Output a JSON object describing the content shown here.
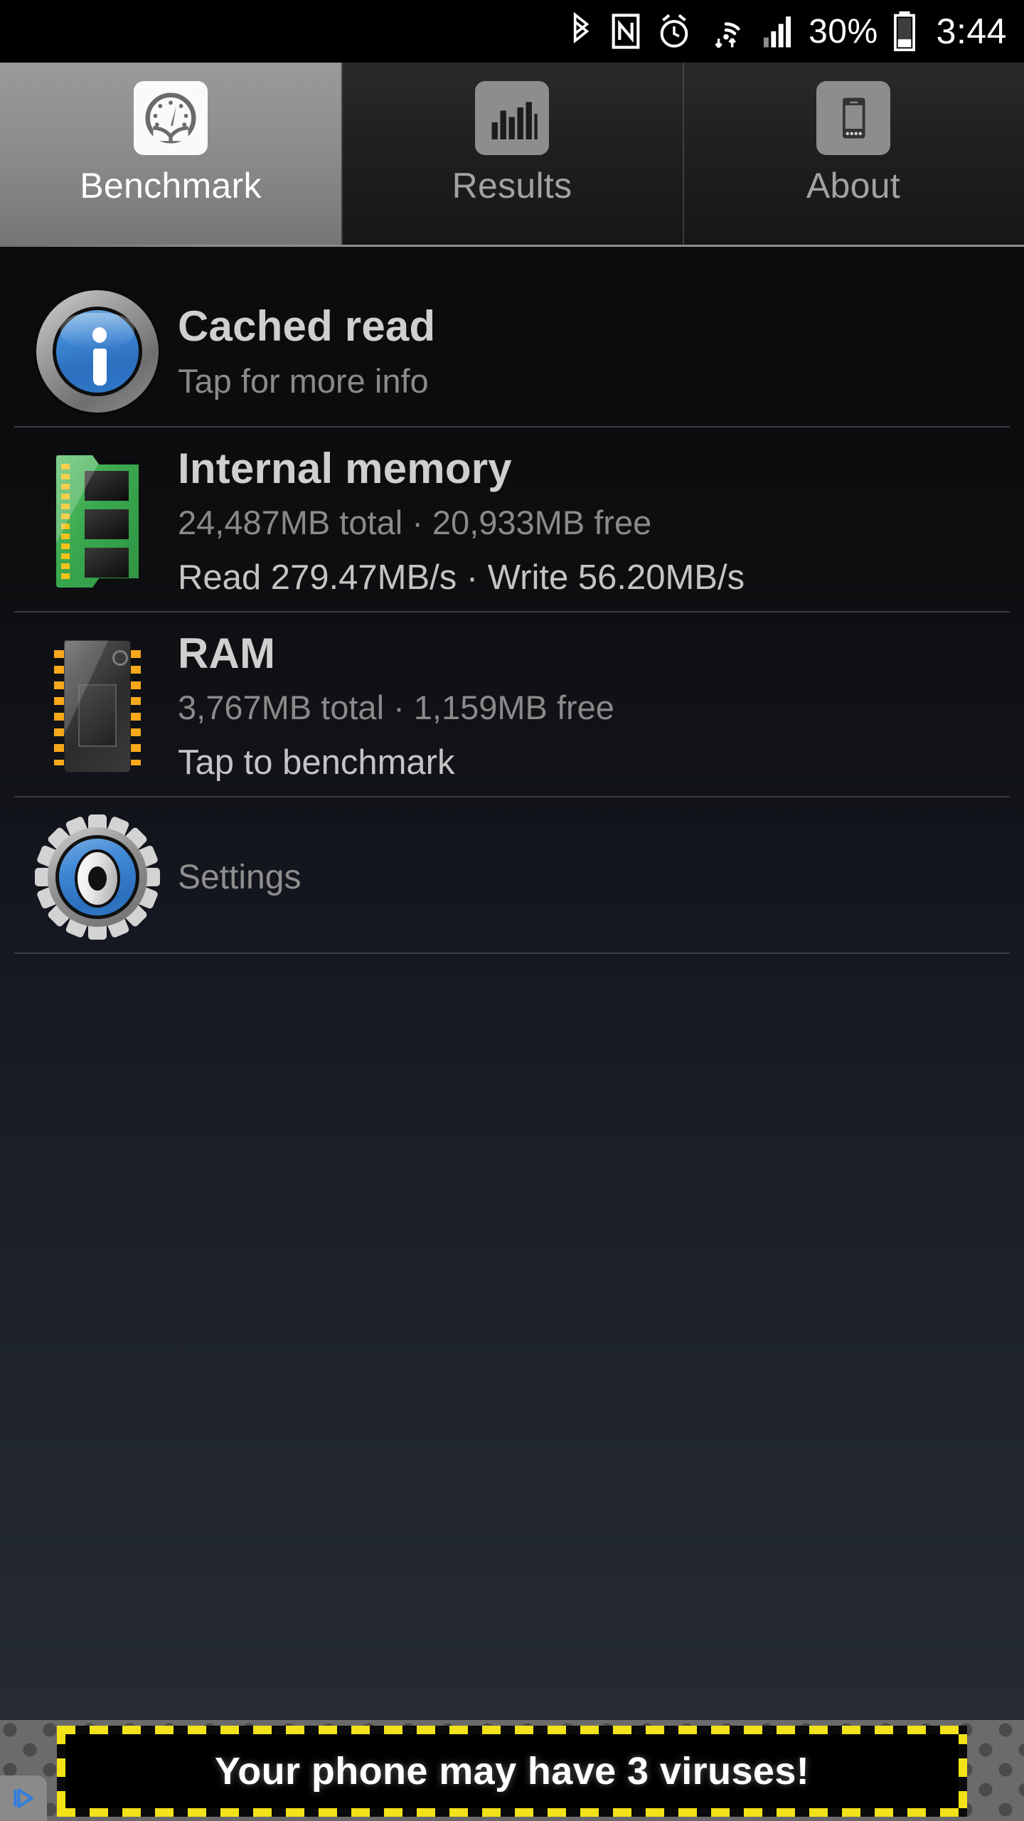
{
  "status_bar": {
    "icons": [
      "bluetooth-icon",
      "nfc-icon",
      "alarm-icon",
      "wifi-icon",
      "signal-icon",
      "battery-icon"
    ],
    "battery_percent": "30%",
    "time": "3:44"
  },
  "tabs": [
    {
      "label": "Benchmark",
      "icon": "speedometer-icon",
      "active": true
    },
    {
      "label": "Results",
      "icon": "bar-chart-icon",
      "active": false
    },
    {
      "label": "About",
      "icon": "phone-icon",
      "active": false
    }
  ],
  "list": {
    "cached_read": {
      "title": "Cached read",
      "subtitle": "Tap for more info",
      "icon": "info-icon"
    },
    "internal_memory": {
      "title": "Internal memory",
      "capacity": "24,487MB total · 20,933MB free",
      "speeds": "Read 279.47MB/s · Write 56.20MB/s",
      "icon": "memory-module-icon"
    },
    "ram": {
      "title": "RAM",
      "capacity": "3,767MB total · 1,159MB free",
      "action": "Tap to benchmark",
      "icon": "ram-chip-icon"
    },
    "settings": {
      "label": "Settings",
      "icon": "gear-icon"
    }
  },
  "ad": {
    "text": "Your phone may have 3 viruses!",
    "adchoices_icon": "adchoices-icon"
  },
  "colors": {
    "accent_blue": "#3d86d4",
    "memory_green": "#3aa84e",
    "pin_yellow": "#f5c21a",
    "hazard_yellow": "#f2e21a",
    "tab_active_bg": "#8f8f8f",
    "title_text": "#cfcfcf",
    "sub_text": "#8a8a8a"
  }
}
